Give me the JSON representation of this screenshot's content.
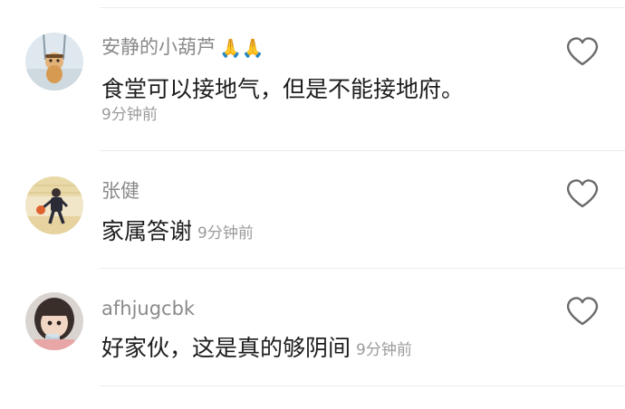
{
  "comments": [
    {
      "username": "安静的小葫芦",
      "emoji": "🙏🙏",
      "content": "食堂可以接地气，但是不能接地府。",
      "time": "9分钟前",
      "avatar_icon": "cartoon-avatar-icon"
    },
    {
      "username": "张健",
      "content": "家属答谢",
      "time": "9分钟前",
      "avatar_icon": "basketball-player-avatar-icon"
    },
    {
      "username": "afhjugcbk",
      "content": "好家伙，这是真的够阴间",
      "time": "9分钟前",
      "avatar_icon": "child-photo-avatar-icon"
    }
  ],
  "colors": {
    "username": "#8a8a8a",
    "content": "#1d1d1d",
    "time": "#9b9b9b",
    "like_icon": "#6b6b6b",
    "divider": "#ececec"
  }
}
